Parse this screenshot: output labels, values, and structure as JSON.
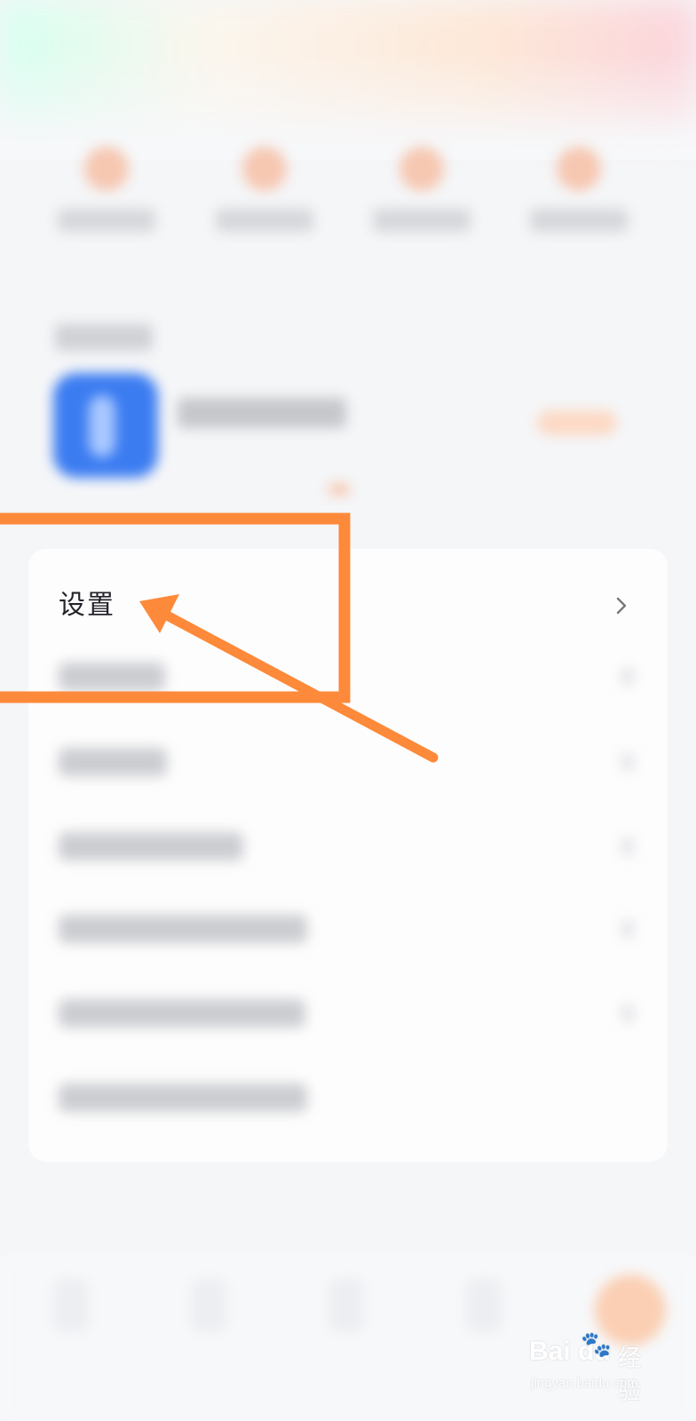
{
  "menu": {
    "settings_label": "设置"
  },
  "icons": {
    "settings_chevron": "chevron-right-icon",
    "watermark_logo": "baidu-paw-icon"
  },
  "colors": {
    "annotation": "#fd8a3a",
    "app_icon": "#3b7cf1",
    "accent_pill": "#fcd9c4"
  },
  "watermark": {
    "brand": "Bai du",
    "product": "经验",
    "url": "jingyan.baidu.com"
  }
}
